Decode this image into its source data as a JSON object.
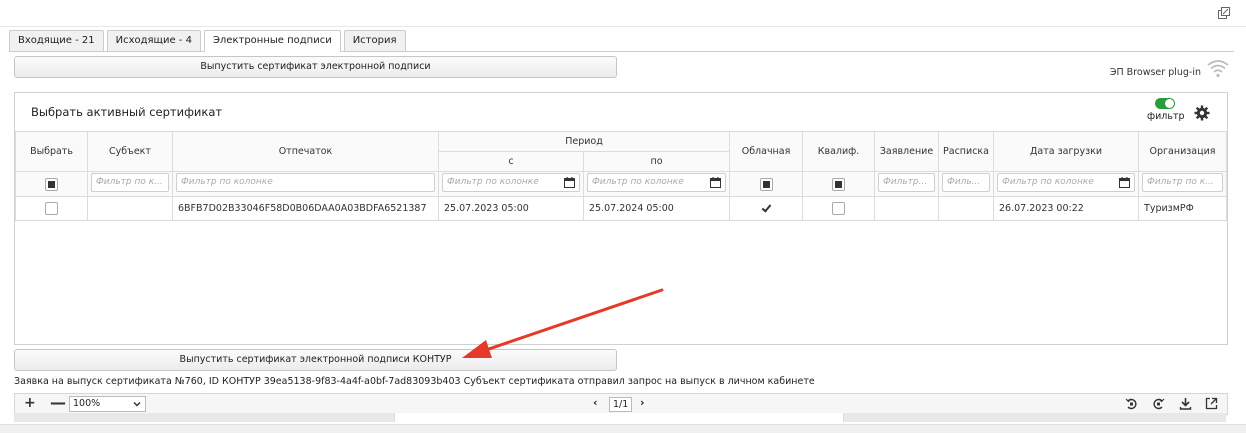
{
  "tabs": [
    {
      "label": "Входящие - 21"
    },
    {
      "label": "Исходящие - 4"
    },
    {
      "label": "Электронные подписи"
    },
    {
      "label": "История"
    }
  ],
  "issue_button": "Выпустить сертификат электронной подписи",
  "plugin_label": "ЭП Browser plug-in",
  "panel": {
    "title": "Выбрать активный сертификат",
    "filter_label": "фильтр"
  },
  "table": {
    "group_header": "Период",
    "columns": {
      "select": "Выбрать",
      "subject": "Субъект",
      "thumbprint": "Отпечаток",
      "from": "с",
      "to": "по",
      "cloud": "Облачная",
      "qualified": "Квалиф.",
      "application": "Заявление",
      "receipt": "Расписка",
      "upload_date": "Дата загрузки",
      "organization": "Организация"
    },
    "filter_placeholders": {
      "subject": "Фильтр по к...",
      "thumbprint": "Фильтр по колонке",
      "from": "Фильтр по колонке",
      "to": "Фильтр по колонке",
      "application": "Фильтр...",
      "receipt": "Филь...",
      "upload_date": "Фильтр по колонке",
      "organization": "Фильтр по к..."
    },
    "rows": [
      {
        "subject": "",
        "thumbprint": "6BFB7D02B33046F58D0B06DAA0A03BDFA6521387",
        "from": "25.07.2023 05:00",
        "to": "25.07.2024 05:00",
        "cloud_checked": true,
        "qualified_checked": false,
        "application": "",
        "receipt": "",
        "upload_date": "26.07.2023 00:22",
        "organization": "ТуризмРФ"
      }
    ]
  },
  "kontur_button": "Выпустить сертификат электронной подписи КОНТУР",
  "note": "Заявка на выпуск сертификата №760, ID КОНТУР 39ea5138-9f83-4a4f-a0bf-7ad83093b403 Субъект сертификата отправил запрос на выпуск в личном кабинете",
  "toolbar": {
    "plus": "+",
    "minus": "—",
    "zoom": "100%",
    "page": "1/1"
  },
  "colors": {
    "toggle_on": "#2e9b3a",
    "arrow": "#e53a2a"
  }
}
